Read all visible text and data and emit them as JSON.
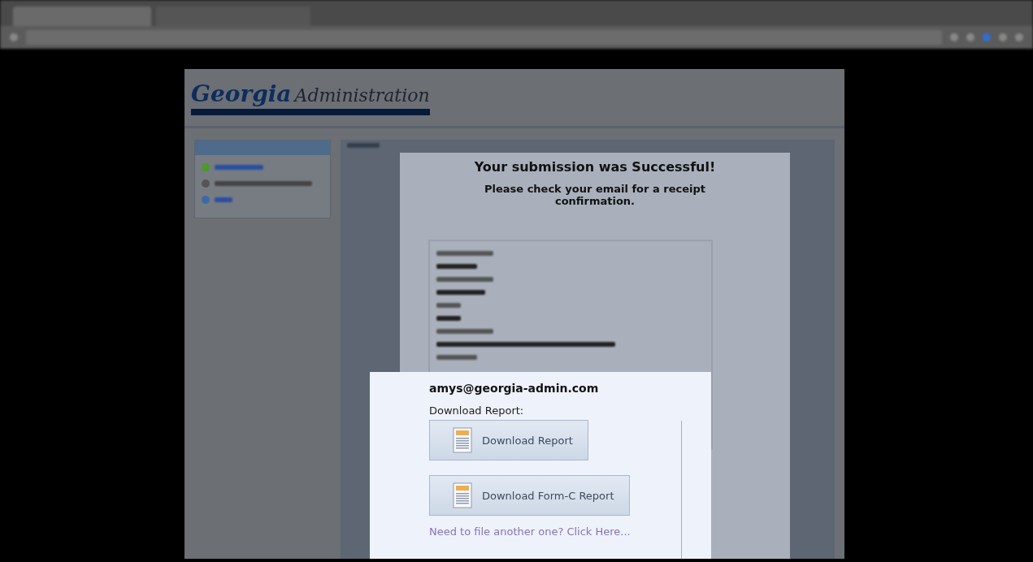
{
  "logo": {
    "brand": "Georgia",
    "suffix": "Administration"
  },
  "result": {
    "heading": "Your submission was Successful!",
    "subheading": "Please check your email for a receipt confirmation."
  },
  "report_panel": {
    "email": "amys@georgia-admin.com",
    "download_label": "Download Report:",
    "buttons": [
      {
        "label": "Download Report"
      },
      {
        "label": "Download Form-C Report"
      }
    ],
    "link": "Need to file another one? Click Here..."
  }
}
